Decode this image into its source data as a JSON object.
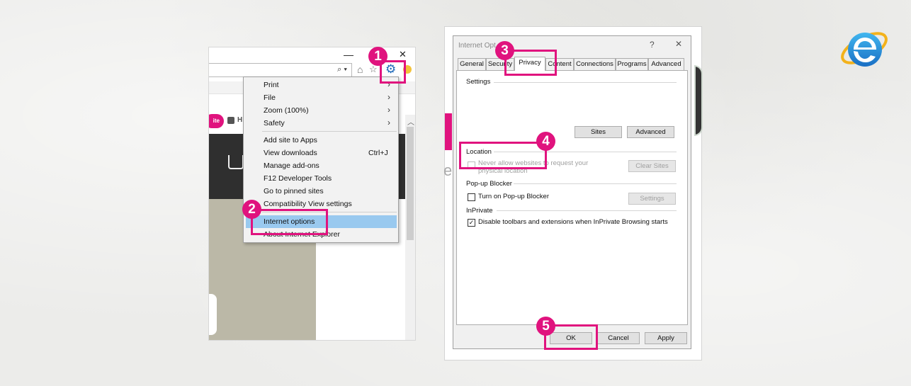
{
  "browser": {
    "minimize_glyph": "—",
    "close_glyph": "✕",
    "search_glyph": "⌕ ▾",
    "promo_text": "ite",
    "promo_h": "H",
    "tools_menu": {
      "items": [
        {
          "label": "Print",
          "arrow": "›"
        },
        {
          "label": "File",
          "arrow": "›"
        },
        {
          "label": "Zoom (100%)",
          "arrow": "›"
        },
        {
          "label": "Safety",
          "arrow": "›"
        },
        {
          "label": "Add site to Apps"
        },
        {
          "label": "View downloads",
          "shortcut": "Ctrl+J"
        },
        {
          "label": "Manage add-ons"
        },
        {
          "label": "F12 Developer Tools"
        },
        {
          "label": "Go to pinned sites"
        },
        {
          "label": "Compatibility View settings"
        },
        {
          "label": "Internet options"
        },
        {
          "label": "About Internet Explorer"
        }
      ]
    }
  },
  "dialog": {
    "title": "Internet Opt",
    "help_glyph": "?",
    "close_glyph": "✕",
    "tabs": [
      "General",
      "Security",
      "Privacy",
      "Content",
      "Connections",
      "Programs",
      "Advanced"
    ],
    "active_tab": "Privacy",
    "settings_group": "Settings",
    "sites_button": "Sites",
    "advanced_button": "Advanced",
    "location_group": "Location",
    "location_checkbox_line1": "Never allow websites to request your",
    "location_checkbox_line2": "physical location",
    "clear_sites_button": "Clear Sites",
    "popup_group": "Pop-up Blocker",
    "popup_checkbox": "Turn on Pop-up Blocker",
    "popup_settings_button": "Settings",
    "inprivate_group": "InPrivate",
    "inprivate_checkbox": "Disable toolbars and extensions when InPrivate Browsing starts",
    "inprivate_checked": true,
    "ok_button": "OK",
    "cancel_button": "Cancel",
    "apply_button": "Apply"
  },
  "steps": [
    "1",
    "2",
    "3",
    "4",
    "5"
  ],
  "colors": {
    "highlight": "#e0137e",
    "menu_selection": "#99c9ef",
    "gear_blue": "#1c68b8"
  }
}
